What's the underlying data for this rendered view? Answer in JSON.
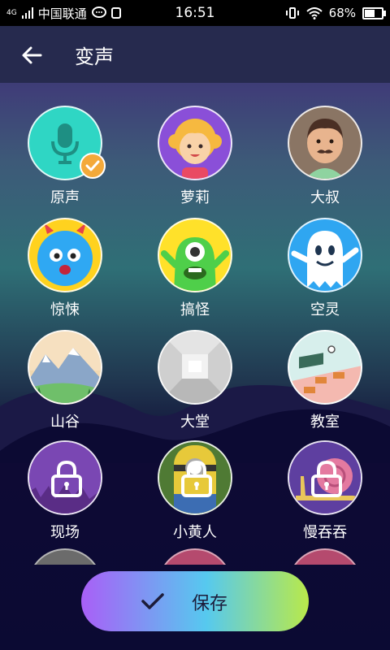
{
  "status_bar": {
    "network_type": "4G",
    "carrier": "中国联通",
    "time": "16:51",
    "battery_percent": "68%",
    "battery_level": 0.68
  },
  "header": {
    "title": "变声"
  },
  "voices": [
    {
      "label": "原声",
      "selected": true,
      "locked": false,
      "icon": "microphone-icon"
    },
    {
      "label": "萝莉",
      "selected": false,
      "locked": false,
      "icon": "girl-avatar-icon"
    },
    {
      "label": "大叔",
      "selected": false,
      "locked": false,
      "icon": "man-avatar-icon"
    },
    {
      "label": "惊悚",
      "selected": false,
      "locked": false,
      "icon": "monster-icon"
    },
    {
      "label": "搞怪",
      "selected": false,
      "locked": false,
      "icon": "alien-icon"
    },
    {
      "label": "空灵",
      "selected": false,
      "locked": false,
      "icon": "ghost-icon"
    },
    {
      "label": "山谷",
      "selected": false,
      "locked": false,
      "icon": "mountain-icon"
    },
    {
      "label": "大堂",
      "selected": false,
      "locked": false,
      "icon": "hall-icon"
    },
    {
      "label": "教室",
      "selected": false,
      "locked": false,
      "icon": "classroom-icon"
    },
    {
      "label": "现场",
      "selected": false,
      "locked": true,
      "icon": "concert-icon"
    },
    {
      "label": "小黄人",
      "selected": false,
      "locked": true,
      "icon": "minion-icon"
    },
    {
      "label": "慢吞吞",
      "selected": false,
      "locked": true,
      "icon": "snail-icon"
    }
  ],
  "save_button": {
    "label": "保存"
  },
  "colors": {
    "accent_orange": "#f4a93a",
    "header_bg": "#262a4e"
  }
}
